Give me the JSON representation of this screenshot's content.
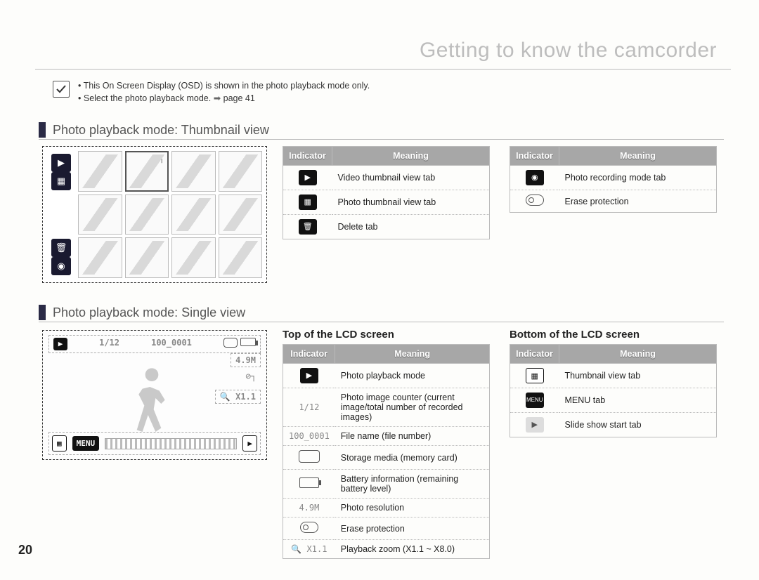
{
  "chapter_title": "Getting to know the camcorder",
  "notes": {
    "line1": "This On Screen Display (OSD) is shown in the photo playback mode only.",
    "line2_a": "Select the photo playback mode.",
    "line2_b": "page 41"
  },
  "section1_title": "Photo playback mode: Thumbnail view",
  "section2_title": "Photo playback mode: Single view",
  "table_headers": {
    "indicator": "Indicator",
    "meaning": "Meaning"
  },
  "top_lcd_label": "Top of the LCD screen",
  "bottom_lcd_label": "Bottom of the LCD screen",
  "thumb_table_left": [
    {
      "meaning": "Video thumbnail view tab"
    },
    {
      "meaning": "Photo thumbnail view tab"
    },
    {
      "meaning": "Delete tab"
    }
  ],
  "thumb_table_right": [
    {
      "meaning": "Photo recording mode tab"
    },
    {
      "meaning": "Erase protection"
    }
  ],
  "single_top_table": [
    {
      "ind": "",
      "meaning": "Photo playback mode"
    },
    {
      "ind": "1/12",
      "meaning": "Photo image counter (current image/total number of recorded images)"
    },
    {
      "ind": "100_0001",
      "meaning": "File name (file number)"
    },
    {
      "ind": "",
      "meaning": "Storage media (memory card)"
    },
    {
      "ind": "",
      "meaning": "Battery information (remaining battery level)"
    },
    {
      "ind": "4.9M",
      "meaning": "Photo resolution"
    },
    {
      "ind": "",
      "meaning": "Erase protection"
    },
    {
      "ind": "🔍 X1.1",
      "meaning": "Playback zoom (X1.1 ~ X8.0)"
    }
  ],
  "single_bottom_table": [
    {
      "meaning": "Thumbnail view tab"
    },
    {
      "meaning": "MENU tab"
    },
    {
      "meaning": "Slide show start tab"
    }
  ],
  "sv_osd": {
    "counter": "1/12",
    "filename": "100_0001",
    "res": "4.9M",
    "zoom": "🔍 X1.1",
    "menu": "MENU"
  },
  "page_number": "20"
}
